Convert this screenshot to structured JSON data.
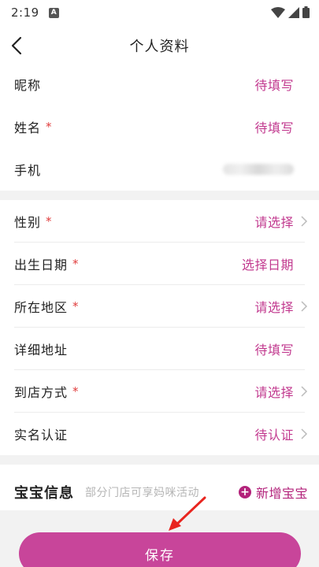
{
  "status": {
    "time": "2:19",
    "a_badge": "A"
  },
  "nav": {
    "title": "个人资料"
  },
  "group1": [
    {
      "label": "昵称",
      "required": false,
      "value": "待填写"
    },
    {
      "label": "姓名",
      "required": true,
      "value": "待填写"
    },
    {
      "label": "手机",
      "required": false,
      "value": ""
    }
  ],
  "group2": [
    {
      "label": "性别",
      "required": true,
      "value": "请选择"
    },
    {
      "label": "出生日期",
      "required": true,
      "value": "选择日期"
    },
    {
      "label": "所在地区",
      "required": true,
      "value": "请选择"
    },
    {
      "label": "详细地址",
      "required": false,
      "value": "待填写"
    },
    {
      "label": "到店方式",
      "required": true,
      "value": "请选择"
    },
    {
      "label": "实名认证",
      "required": false,
      "value": "待认证"
    }
  ],
  "required_mark": "*",
  "baby": {
    "title": "宝宝信息",
    "hint": "部分门店可享妈咪活动",
    "add_icon": "+",
    "add_label": "新增宝宝"
  },
  "footer": {
    "save_label": "保存"
  },
  "colors": {
    "accent": "#c23a8f",
    "button": "#c8459a",
    "required": "#e03c3c"
  }
}
